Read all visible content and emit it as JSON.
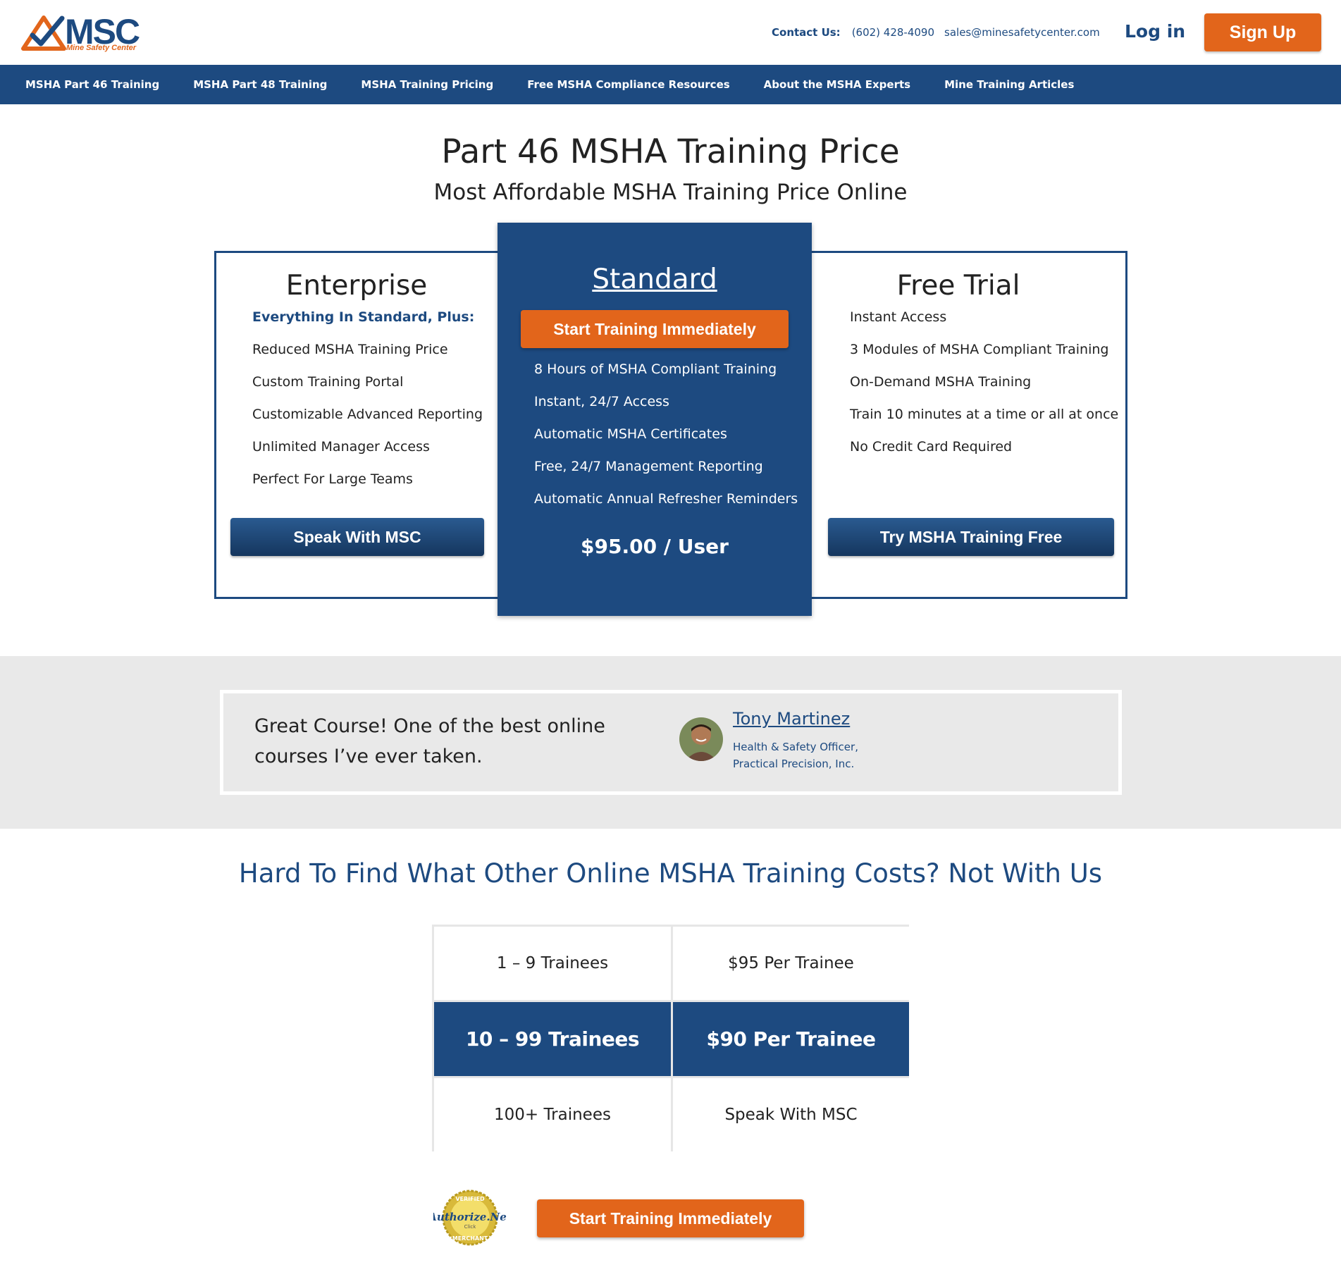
{
  "header": {
    "logo_text": "MSC",
    "logo_sub": "Mine Safety Center",
    "contact_label": "Contact Us:",
    "phone": "(602) 428-4090",
    "email": "sales@minesafetycenter.com",
    "login_label": "Log in",
    "signup_label": "Sign Up"
  },
  "nav": {
    "items": [
      "MSHA Part 46 Training",
      "MSHA Part 48 Training",
      "MSHA Training Pricing",
      "Free MSHA Compliance Resources",
      "About the MSHA Experts",
      "Mine Training Articles"
    ]
  },
  "hero": {
    "title": "Part 46 MSHA Training Price",
    "subtitle": "Most Affordable MSHA Training Price Online"
  },
  "plans": {
    "enterprise": {
      "title": "Enterprise",
      "highlight": "Everything In Standard, Plus:",
      "features": [
        "Reduced MSHA Training Price",
        "Custom Training Portal",
        "Customizable Advanced Reporting",
        "Unlimited Manager Access",
        "Perfect For Large Teams"
      ],
      "button": "Speak With MSC"
    },
    "standard": {
      "title": "Standard",
      "button": "Start Training Immediately",
      "features": [
        "8 Hours of MSHA Compliant Training",
        "Instant, 24/7 Access",
        "Automatic MSHA Certificates",
        "Free, 24/7 Management Reporting",
        "Automatic Annual Refresher Reminders"
      ],
      "price": "$95.00 / User"
    },
    "free_trial": {
      "title": "Free Trial",
      "features": [
        "Instant Access",
        "3 Modules of MSHA Compliant Training",
        "On-Demand MSHA Training",
        "Train 10 minutes at a time or all at once",
        "No Credit Card Required"
      ],
      "button": "Try MSHA Training Free"
    }
  },
  "testimonial": {
    "quote_line1": "Great Course! One of the best online",
    "quote_line2": "courses I’ve ever taken.",
    "name": "Tony Martinez",
    "role_line1": "Health & Safety Officer,",
    "role_line2": "Practical Precision, Inc."
  },
  "costs": {
    "heading": "Hard To Find What Other Online MSHA Training Costs? Not With Us",
    "rows": [
      {
        "trainees": "1 – 9 Trainees",
        "price": "$95 Per Trainee",
        "highlighted": false
      },
      {
        "trainees": "10 – 99 Trainees",
        "price": "$90 Per Trainee",
        "highlighted": true
      },
      {
        "trainees": "100+ Trainees",
        "price": "Speak With MSC",
        "highlighted": false
      }
    ]
  },
  "footer_cta": {
    "seal_text": "Authorize.Net",
    "seal_ring_top": "VERIFIED",
    "seal_ring_bottom": "MERCHANT",
    "seal_click": "Click",
    "button": "Start Training Immediately"
  },
  "colors": {
    "navy": "#1d4a80",
    "orange": "#e2651b",
    "band_gray": "#e9e9e9"
  }
}
